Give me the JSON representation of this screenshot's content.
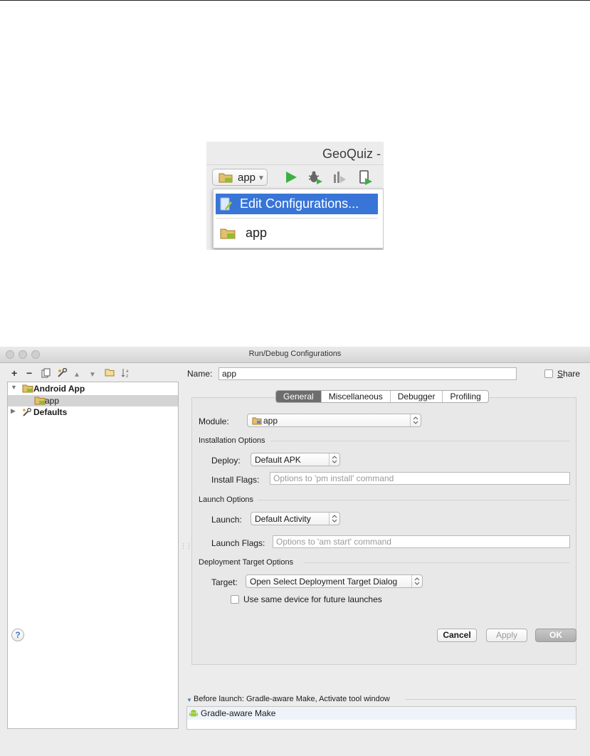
{
  "snippet": {
    "window_title": "GeoQuiz -",
    "config_combo": {
      "label": "app"
    },
    "toolbar_icons": [
      "run-icon",
      "debug-icon",
      "profile-icon",
      "apply-changes-icon"
    ],
    "menu": {
      "items": [
        {
          "label": "Edit Configurations...",
          "icon": "edit-configurations-icon",
          "selected": true
        },
        {
          "label": "app",
          "icon": "android-module-icon",
          "selected": false
        }
      ]
    }
  },
  "dialog": {
    "title": "Run/Debug Configurations",
    "left_toolbar": [
      "add-icon",
      "remove-icon",
      "copy-icon",
      "edit-defaults-icon",
      "move-up-icon",
      "move-down-icon",
      "folder-icon",
      "sort-icon"
    ],
    "tree": {
      "android_app": "Android App",
      "app": "app",
      "defaults": "Defaults"
    },
    "name_label": "Name:",
    "name_value": "app",
    "share_label_prefix": "",
    "share_label_underlined": "S",
    "share_label_rest": "hare",
    "tabs": [
      "General",
      "Miscellaneous",
      "Debugger",
      "Profiling"
    ],
    "active_tab": "General",
    "general": {
      "module_label": "Module:",
      "module_value": "app",
      "installation_section": "Installation Options",
      "deploy_label": "Deploy:",
      "deploy_value": "Default APK",
      "install_flags_label": "Install Flags:",
      "install_flags_placeholder": "Options to 'pm install' command",
      "launch_section": "Launch Options",
      "launch_label": "Launch:",
      "launch_value": "Default Activity",
      "launch_flags_label": "Launch Flags:",
      "launch_flags_placeholder": "Options to 'am start' command",
      "deployment_section": "Deployment Target Options",
      "target_label": "Target:",
      "target_value": "Open Select Deployment Target Dialog",
      "same_device_label": "Use same device for future launches"
    },
    "before_launch": {
      "title": "Before launch: Gradle-aware Make, Activate tool window",
      "items": [
        "Gradle-aware Make"
      ]
    },
    "buttons": {
      "help": "?",
      "cancel": "Cancel",
      "apply": "Apply",
      "ok": "OK"
    },
    "colors": {
      "selection_blue": "#3875d7",
      "run_green": "#3cb043",
      "android_green": "#9ccc3a",
      "folder_tan": "#d9b15a"
    }
  }
}
